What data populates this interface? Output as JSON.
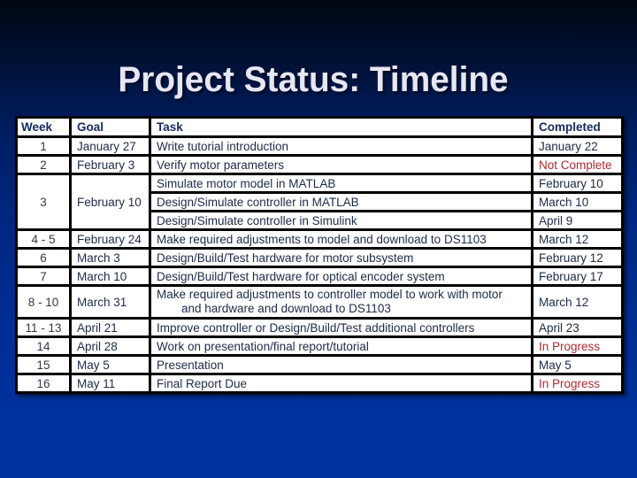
{
  "slide": {
    "title": "Project Status: Timeline"
  },
  "colors": {
    "background_top": "#000712",
    "background_bottom": "#0033a0",
    "title_text": "#e6e6f5",
    "header_text": "#14295e",
    "status_incomplete": "#b02a30"
  },
  "table": {
    "headers": [
      "Week",
      "Goal",
      "Task",
      "Completed"
    ],
    "rows": [
      {
        "week": "1",
        "goal": "January 27",
        "task": "Write tutorial introduction",
        "completed": "January 22"
      },
      {
        "week": "2",
        "goal": "February 3",
        "task": "Verify motor parameters",
        "completed": "Not Complete"
      },
      {
        "week": "3",
        "goal": "February 10",
        "tasks": [
          {
            "task": "Simulate motor model in MATLAB",
            "completed": "February 10"
          },
          {
            "task": "Design/Simulate controller in MATLAB",
            "completed": "March 10"
          },
          {
            "task": "Design/Simulate controller in Simulink",
            "completed": "April 9"
          }
        ]
      },
      {
        "week": "4 - 5",
        "goal": "February 24",
        "task": "Make required adjustments to model and download to DS1103",
        "completed": "March 12"
      },
      {
        "week": "6",
        "goal": "March 3",
        "task": "Design/Build/Test hardware for motor subsystem",
        "completed": "February 12"
      },
      {
        "week": "7",
        "goal": "March 10",
        "task": "Design/Build/Test hardware for optical encoder system",
        "completed": "February 17"
      },
      {
        "week": "8 - 10",
        "goal": "March 31",
        "task_line1": "Make required adjustments to controller model to work with motor",
        "task_line2": "and hardware and download to DS1103",
        "completed": "March 12"
      },
      {
        "week": "11 - 13",
        "goal": "April 21",
        "task": "Improve controller or Design/Build/Test additional controllers",
        "completed": "April 23"
      },
      {
        "week": "14",
        "goal": "April 28",
        "task": "Work on presentation/final report/tutorial",
        "completed": "In Progress"
      },
      {
        "week": "15",
        "goal": "May 5",
        "task": "Presentation",
        "completed": "May 5"
      },
      {
        "week": "16",
        "goal": "May 11",
        "task": "Final Report Due",
        "completed": "In Progress"
      }
    ]
  }
}
